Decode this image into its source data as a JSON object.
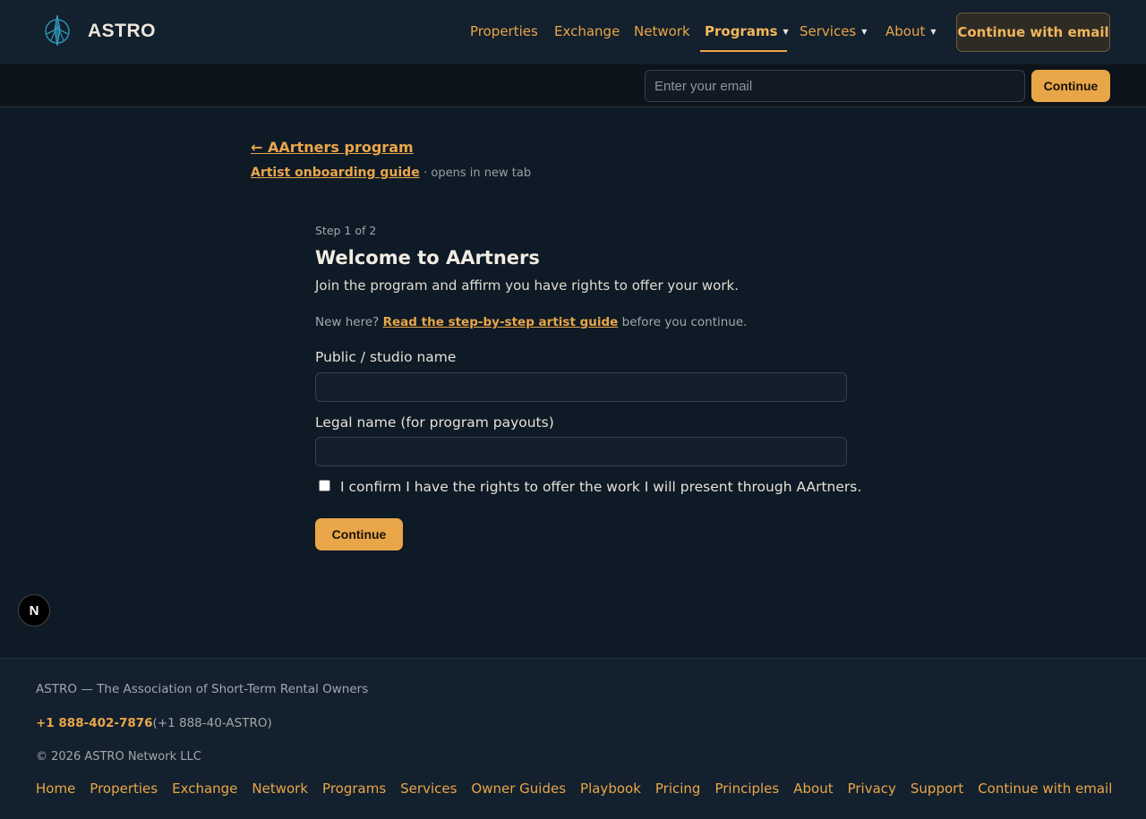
{
  "header": {
    "brand": "ASTRO",
    "nav": [
      {
        "label": "Properties",
        "dropdown": false,
        "active": false
      },
      {
        "label": "Exchange",
        "dropdown": false,
        "active": false
      },
      {
        "label": "Network",
        "dropdown": false,
        "active": false
      },
      {
        "label": "Programs",
        "dropdown": true,
        "active": true
      },
      {
        "label": "Services",
        "dropdown": true,
        "active": false
      },
      {
        "label": "About",
        "dropdown": true,
        "active": false
      }
    ],
    "cta_label": "Continue with email"
  },
  "email_bar": {
    "placeholder": "Enter your email",
    "button_label": "Continue"
  },
  "breadcrumb": {
    "back_label": "← AArtners program",
    "guide_link": "Artist onboarding guide",
    "guide_note": "· opens in new tab"
  },
  "form": {
    "step": "Step 1 of 2",
    "title": "Welcome to AArtners",
    "subtitle": "Join the program and affirm you have rights to offer your work.",
    "new_here_prefix": "New here?",
    "new_here_link": "Read the step-by-step artist guide",
    "new_here_suffix": "before you continue.",
    "public_name_label": "Public / studio name",
    "public_name_value": "",
    "legal_name_label": "Legal name (for program payouts)",
    "legal_name_value": "",
    "confirm_label": "I confirm I have the rights to offer the work I will present through AArtners.",
    "confirm_checked": false,
    "continue_label": "Continue"
  },
  "badge": {
    "label": "N"
  },
  "footer": {
    "tagline": "ASTRO — The Association of Short-Term Rental Owners",
    "phone": "+1 888-402-7876",
    "phone_alt": "(+1 888-40-ASTRO)",
    "copyright": "© 2026 ASTRO Network LLC",
    "links": [
      "Home",
      "Properties",
      "Exchange",
      "Network",
      "Programs",
      "Services",
      "Owner Guides",
      "Playbook",
      "Pricing",
      "Principles",
      "About",
      "Privacy",
      "Support",
      "Continue with email"
    ]
  },
  "colors": {
    "accent": "#e9a649",
    "background": "#0e1a26",
    "header_bg": "#13202d",
    "logo": "#2a8fb0"
  },
  "icons": {
    "logo": "compass-star-icon",
    "dropdown": "caret-down-icon"
  }
}
